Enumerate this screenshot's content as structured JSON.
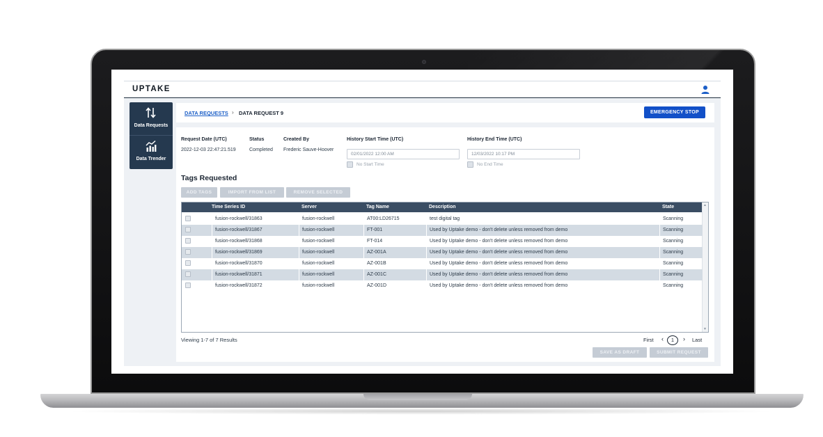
{
  "app": {
    "logo": "UPTAKE"
  },
  "sidebar": {
    "items": [
      {
        "label": "Data Requests",
        "icon": "arrows-up-down-icon"
      },
      {
        "label": "Data Trender",
        "icon": "chart-trend-icon"
      }
    ]
  },
  "breadcrumb": {
    "parent": "DATA REQUESTS",
    "current": "DATA REQUEST 9"
  },
  "actions": {
    "emergency_stop": "EMERGENCY STOP"
  },
  "meta": {
    "request_date_label": "Request Date (UTC)",
    "request_date": "2022-12-03 22:47:21.519",
    "status_label": "Status",
    "status": "Completed",
    "created_by_label": "Created By",
    "created_by": "Frederic Sauve-Hoover",
    "history_start_label": "History Start Time (UTC)",
    "history_start_value": "02/01/2022 12:00 AM",
    "no_start_label": "No Start Time",
    "history_end_label": "History End Time (UTC)",
    "history_end_value": "12/03/2022 10:17 PM",
    "no_end_label": "No End Time"
  },
  "tags": {
    "title": "Tags Requested",
    "buttons": {
      "add": "ADD TAGS",
      "import": "IMPORT FROM LIST",
      "remove": "REMOVE SELECTED"
    },
    "columns": [
      "Time Series ID",
      "Server",
      "Tag Name",
      "Description",
      "State"
    ],
    "rows": [
      {
        "id": "fusion-rockwell/31863",
        "server": "fusion-rockwell",
        "tag": "AT00:LD26715",
        "description": "test digital tag",
        "state": "Scanning"
      },
      {
        "id": "fusion-rockwell/31867",
        "server": "fusion-rockwell",
        "tag": "FT-001",
        "description": "Used by Uptake demo - don't delete unless removed from demo",
        "state": "Scanning"
      },
      {
        "id": "fusion-rockwell/31868",
        "server": "fusion-rockwell",
        "tag": "FT-014",
        "description": "Used by Uptake demo - don't delete unless removed from demo",
        "state": "Scanning"
      },
      {
        "id": "fusion-rockwell/31869",
        "server": "fusion-rockwell",
        "tag": "AZ-001A",
        "description": "Used by Uptake demo - don't delete unless removed from demo",
        "state": "Scanning"
      },
      {
        "id": "fusion-rockwell/31870",
        "server": "fusion-rockwell",
        "tag": "AZ-001B",
        "description": "Used by Uptake demo - don't delete unless removed from demo",
        "state": "Scanning"
      },
      {
        "id": "fusion-rockwell/31871",
        "server": "fusion-rockwell",
        "tag": "AZ-001C",
        "description": "Used by Uptake demo - don't delete unless removed from demo",
        "state": "Scanning"
      },
      {
        "id": "fusion-rockwell/31872",
        "server": "fusion-rockwell",
        "tag": "AZ-001D",
        "description": "Used by Uptake demo - don't delete unless removed from demo",
        "state": "Scanning"
      }
    ],
    "viewing": "Viewing 1-7 of 7 Results"
  },
  "pagination": {
    "first": "First",
    "prev": "‹",
    "current": "1",
    "next": "›",
    "last": "Last"
  },
  "footer": {
    "save_draft": "SAVE AS DRAFT",
    "submit": "SUBMIT REQUEST"
  },
  "colors": {
    "accent": "#1250c8",
    "sidebar": "#25394f",
    "table_header": "#3a4d63",
    "row_alt": "#d3dbe3"
  }
}
